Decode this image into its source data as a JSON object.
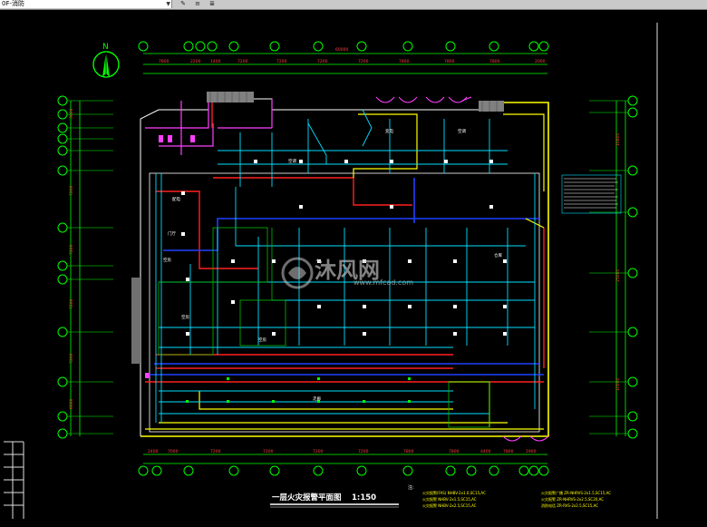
{
  "toolbar": {
    "layer_value": "0F-消防",
    "buttons": [
      "pen",
      "layer-prev",
      "layer-state"
    ]
  },
  "drawing": {
    "title": "一层火灾报警平面图",
    "title_scale": "1:150",
    "north_label": "N",
    "rooms": [
      "配电",
      "空调",
      "变电",
      "走廊",
      "空房",
      "门厅",
      "仓库"
    ],
    "col_labels_top": [
      "1",
      "2",
      "3",
      "4",
      "5",
      "6",
      "7",
      "8",
      "9",
      "10",
      "11",
      "12"
    ],
    "row_labels_left": [
      "M",
      "L",
      "K",
      "J",
      "H",
      "G",
      "F",
      "E",
      "D",
      "C",
      "B",
      "A"
    ],
    "notes_label": "注:",
    "notes_left": [
      "火灾报警(FAS) NHBV-2x1.0,SC15,AC",
      "火灾报警 NHBV-2x1.5,SC15,AC",
      "火灾报警 NHBV-2x2.5,SC15,AC"
    ],
    "notes_right": [
      "火灾报警广播 ZR-NHRVS-2x1.5,SC15,AC",
      "火灾报警 ZR-NHRVS-2x2.5,SC20,AC",
      "消防电话 ZR-RVS-2x2.5,SC15,AC"
    ],
    "watermark_main": "沐风网",
    "watermark_url": "www.mfcad.com"
  }
}
